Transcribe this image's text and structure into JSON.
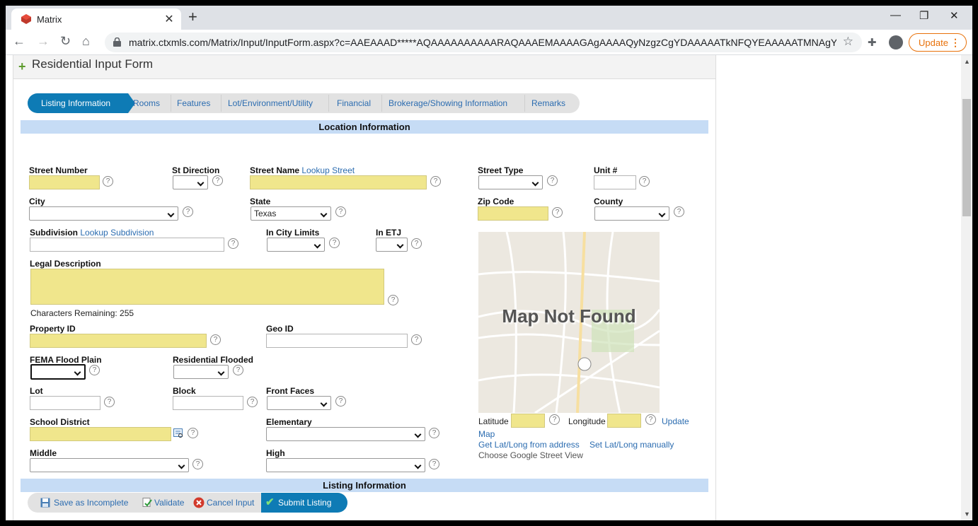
{
  "browser": {
    "tab_title": "Matrix",
    "tab_close": "✕",
    "new_tab": "+",
    "url": "matrix.ctxmls.com/Matrix/Input/InputForm.aspx?c=AAEAAAD*****AQAAAAAAAAAARAQAAAEMAAAAGAgAAAAQyNzgzCgYDAAAAATkNFQYEAAAAATMNAgYFA...",
    "update_label": "Update",
    "minimize": "—",
    "restore": "❐",
    "close": "✕"
  },
  "form": {
    "title": "Residential Input Form",
    "steps": [
      "Listing Information",
      "Rooms",
      "Features",
      "Lot/Environment/Utility",
      "Financial",
      "Brokerage/Showing Information",
      "Remarks"
    ],
    "section_location": "Location Information",
    "section_listing": "Listing Information",
    "fields": {
      "street_number": "Street Number",
      "st_direction": "St Direction",
      "street_name": "Street Name",
      "lookup_street": "Lookup Street",
      "street_type": "Street Type",
      "unit": "Unit #",
      "city": "City",
      "state": "State",
      "state_value": "Texas",
      "zip": "Zip Code",
      "county": "County",
      "subdivision": "Subdivision",
      "lookup_subdivision": "Lookup Subdivision",
      "in_city_limits": "In City Limits",
      "in_etj": "In ETJ",
      "legal_description": "Legal Description",
      "chars_remaining": "Characters Remaining: 255",
      "property_id": "Property ID",
      "geo_id": "Geo ID",
      "fema": "FEMA Flood Plain",
      "residential_flooded": "Residential Flooded",
      "lot": "Lot",
      "block": "Block",
      "front_faces": "Front Faces",
      "school_district": "School District",
      "elementary": "Elementary",
      "middle": "Middle",
      "high": "High",
      "help": "?"
    },
    "map": {
      "not_found": "Map Not Found",
      "latitude": "Latitude",
      "longitude": "Longitude",
      "update_map": "Update",
      "map_word": "Map",
      "get_latlong": "Get Lat/Long from address",
      "set_latlong": "Set Lat/Long manually",
      "street_view": "Choose Google Street View"
    },
    "actions": {
      "save_incomplete": "Save as Incomplete",
      "validate": "Validate",
      "cancel": "Cancel Input",
      "submit": "Submit Listing"
    }
  }
}
